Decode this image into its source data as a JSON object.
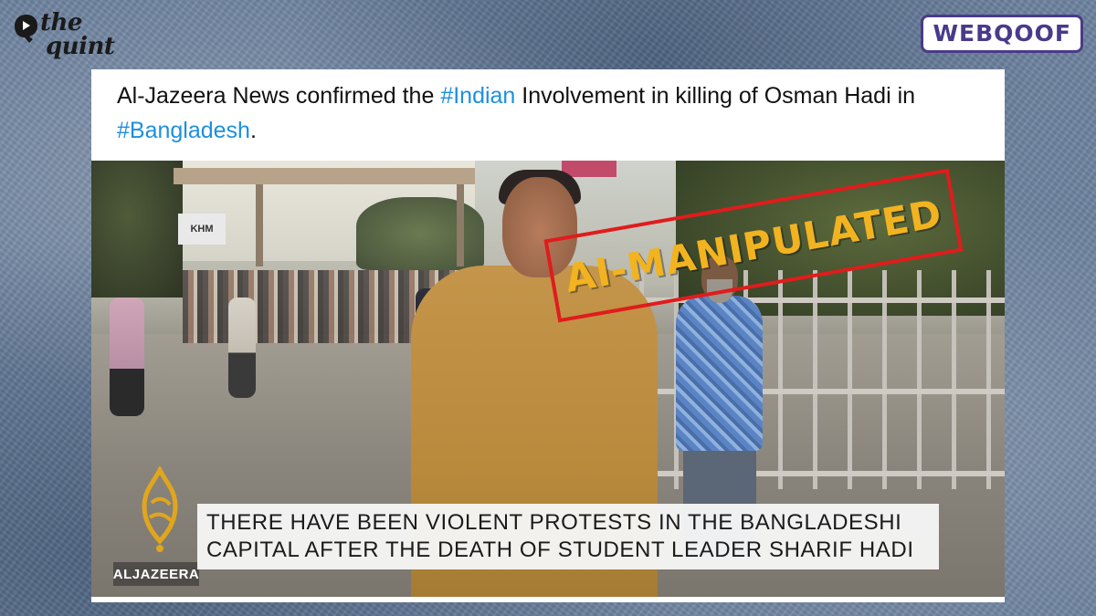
{
  "brand": {
    "quint_line1": "the",
    "quint_line2": "quint",
    "webqoof": "WEBQOOF",
    "webqoof_color": "#4a3a8a"
  },
  "tweet": {
    "text_part1": "Al-Jazeera News confirmed the ",
    "hashtag1": "#Indian",
    "text_part2": " Involvement in killing of Osman Hadi in ",
    "hashtag2": "#Bangladesh",
    "text_part3": ".",
    "hashtag_color": "#1d8fe0"
  },
  "video": {
    "stamp_label": "AI-MANIPULATED",
    "stamp_border_color": "#e01c1c",
    "stamp_text_color": "#f2b320",
    "street_sign": "KHM",
    "channel_label": "ALJAZEERA",
    "caption_line1": "THERE HAVE BEEN VIOLENT PROTESTS IN THE BANGLADESHI",
    "caption_line2": "CAPITAL AFTER THE DEATH OF STUDENT LEADER SHARIF HADI"
  }
}
